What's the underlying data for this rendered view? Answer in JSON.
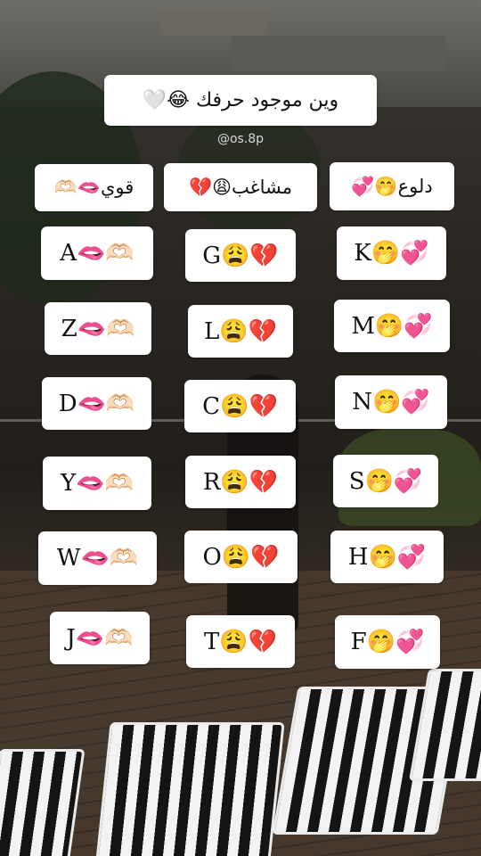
{
  "title": "وين موجود حرفك 😂🤍",
  "handle": "@os.8p",
  "categories": {
    "right": "دلوع🤭💞",
    "middle": "مشاغب😩💔",
    "left": "قوي🫦🫶🏻"
  },
  "columns": {
    "left": [
      "A🫦🫶🏻",
      "Z🫦🫶🏻",
      "D🫦🫶🏻",
      "Y🫦🫶🏻",
      "W🫦🫶🏻",
      "J🫦🫶🏻"
    ],
    "middle": [
      "G😩💔",
      "L😩💔",
      "C😩💔",
      "R😩💔",
      "O😩💔",
      "T😩💔"
    ],
    "right": [
      "K🤭💞",
      "M🤭💞",
      "N🤭💞",
      "S🤭💞",
      "H🤭💞",
      "F🤭💞"
    ]
  }
}
